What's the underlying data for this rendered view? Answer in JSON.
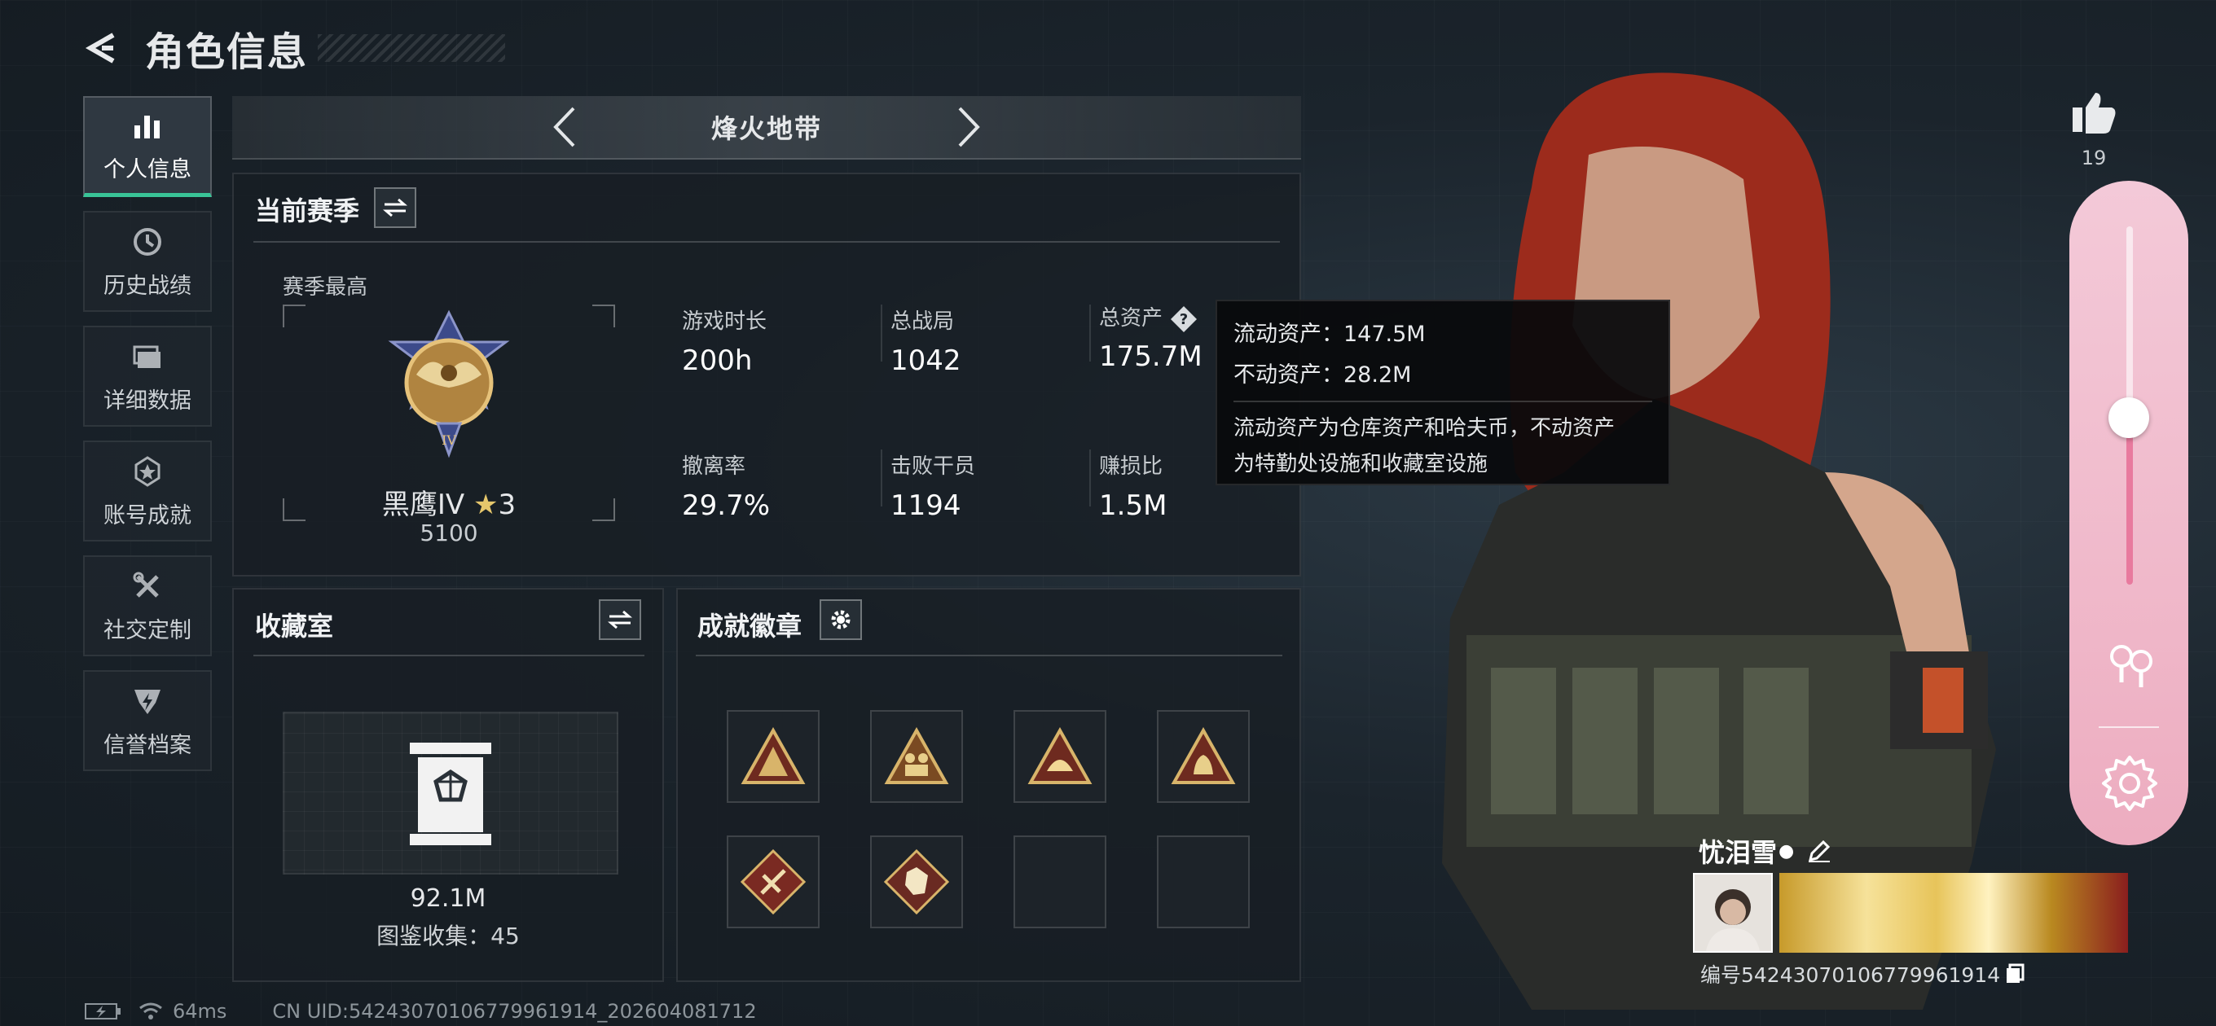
{
  "header": {
    "title": "角色信息"
  },
  "sidebar": {
    "items": [
      {
        "label": "个人信息",
        "icon": "bar-chart-icon",
        "active": true
      },
      {
        "label": "历史战绩",
        "icon": "history-icon"
      },
      {
        "label": "详细数据",
        "icon": "folder-icon"
      },
      {
        "label": "账号成就",
        "icon": "achievement-icon"
      },
      {
        "label": "社交定制",
        "icon": "tools-icon"
      },
      {
        "label": "信誉档案",
        "icon": "credit-shield-icon"
      }
    ]
  },
  "mode": {
    "title": "烽火地带"
  },
  "season": {
    "title": "当前赛季",
    "best_label": "赛季最高",
    "rank_name": "黑鹰IV",
    "rank_stars": "3",
    "rank_score": "5100",
    "stats": [
      {
        "label": "游戏时长",
        "value": "200h"
      },
      {
        "label": "总战局",
        "value": "1042"
      },
      {
        "label": "总资产",
        "value": "175.7M"
      },
      {
        "label": "撤离率",
        "value": "29.7%"
      },
      {
        "label": "击败干员",
        "value": "1194"
      },
      {
        "label": "赚损比",
        "value": "1.5M"
      }
    ]
  },
  "tooltip": {
    "line1": "流动资产：147.5M",
    "line2": "不动资产：28.2M",
    "note1": "流动资产为仓库资产和哈夫币，不动资产",
    "note2": "为特勤处设施和收藏室设施"
  },
  "collection": {
    "title": "收藏室",
    "value": "92.1M",
    "count": "图鉴收集：45"
  },
  "badges": {
    "title": "成就徽章",
    "slots": [
      {
        "icon": "badge-tent-icon",
        "filled": true
      },
      {
        "icon": "badge-soldiers-icon",
        "filled": true
      },
      {
        "icon": "badge-helmet-icon",
        "filled": true
      },
      {
        "icon": "badge-hands-icon",
        "filled": true
      },
      {
        "icon": "badge-weapon-icon",
        "filled": true
      },
      {
        "icon": "badge-beast-icon",
        "filled": true
      },
      {
        "icon": "",
        "filled": false
      },
      {
        "icon": "",
        "filled": false
      }
    ]
  },
  "likes": {
    "count": "19"
  },
  "player": {
    "name": "忧泪雪",
    "id_text": "编号5424307010677996191 4",
    "id_display": "编号5424307010677996191​4"
  },
  "statusbar": {
    "ping": "64ms",
    "uid": "CN UID:54243070106779961914_202604081712"
  },
  "colors": {
    "accent": "#39c497",
    "slider": "#f8b4c8"
  }
}
